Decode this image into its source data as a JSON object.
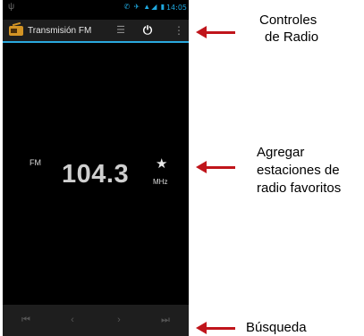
{
  "status_bar": {
    "usb_icon": "usb-icon",
    "status_icons": "✆ ✈ ▲◢ ▮",
    "time": "14:05"
  },
  "action_bar": {
    "title": "Transmisión FM",
    "app_icon": "radio-icon",
    "list_icon": "☰",
    "power_icon": "⏻",
    "menu_icon": "⋮"
  },
  "tuner": {
    "band": "FM",
    "frequency": "104.3",
    "unit": "MHz",
    "favorite_icon": "★"
  },
  "seek_bar": {
    "buttons": [
      {
        "name": "skip-previous",
        "glyph": "⏮"
      },
      {
        "name": "seek-back",
        "glyph": "‹"
      },
      {
        "name": "seek-forward",
        "glyph": "›"
      },
      {
        "name": "skip-next",
        "glyph": "⏭"
      }
    ]
  },
  "annotations": {
    "radio_controls_line1": "Controles",
    "radio_controls_line2": "de Radio",
    "favorites_line1": "Agregar",
    "favorites_line2": "estaciones de",
    "favorites_line3": "radio favoritos",
    "search": "Búsqueda",
    "arrow_color": "#c0151b"
  }
}
